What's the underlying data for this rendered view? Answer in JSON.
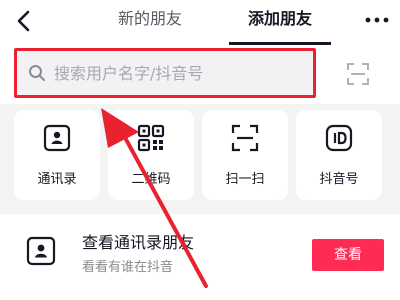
{
  "header": {
    "back_icon": "chevron-left-icon",
    "tabs": [
      {
        "label": "新的朋友",
        "active": false
      },
      {
        "label": "添加朋友",
        "active": true
      }
    ],
    "more_icon": "more-horizontal-icon"
  },
  "search": {
    "placeholder": "搜索用户名字/抖音号",
    "icon": "search-icon",
    "scan_icon": "scan-icon",
    "highlight_color": "#e8232f"
  },
  "quick_actions": [
    {
      "label": "通讯录",
      "icon": "contact-card-icon"
    },
    {
      "label": "二维码",
      "icon": "qr-code-icon"
    },
    {
      "label": "扫一扫",
      "icon": "scan-icon"
    },
    {
      "label": "抖音号",
      "icon": "id-badge-icon"
    }
  ],
  "contacts": {
    "icon": "contact-card-icon",
    "title": "查看通讯录朋友",
    "subtitle": "看看有谁在抖音",
    "button_label": "查看",
    "button_color": "#fe2c55"
  },
  "annotation": {
    "type": "arrow",
    "color": "#e8232f",
    "points_to": "search-box"
  }
}
